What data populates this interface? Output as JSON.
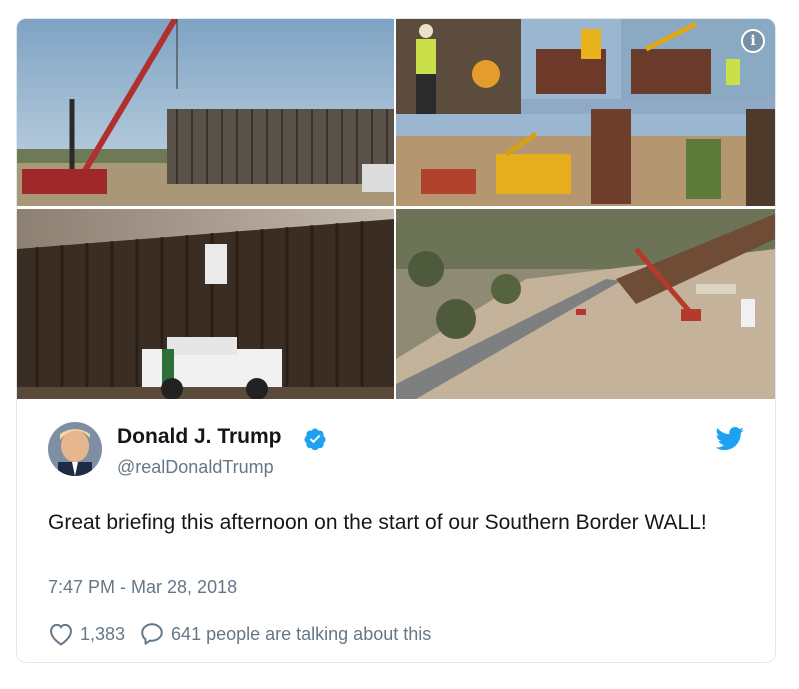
{
  "tweet": {
    "author_name": "Donald J. Trump",
    "handle": "@realDonaldTrump",
    "text": "Great briefing this afternoon on the start of our Southern Border WALL!",
    "timestamp": "7:47 PM - Mar 28, 2018",
    "likes": "1,383",
    "replies_text": "641 people are talking about this"
  },
  "media": {
    "info_glyph": "i",
    "photos": [
      "photo-crane-wall-construction",
      "photo-workers-collage",
      "photo-border-patrol-truck",
      "photo-aerial-wall-construction"
    ]
  },
  "icons": {
    "verified": "verified-badge-icon",
    "bird": "twitter-bird-icon",
    "like": "heart-icon",
    "reply": "comment-icon",
    "info": "info-icon"
  },
  "colors": {
    "twitter_blue": "#1da1f2",
    "secondary_text": "#657786",
    "primary_text": "#14171a",
    "border": "#e1e8ed"
  }
}
